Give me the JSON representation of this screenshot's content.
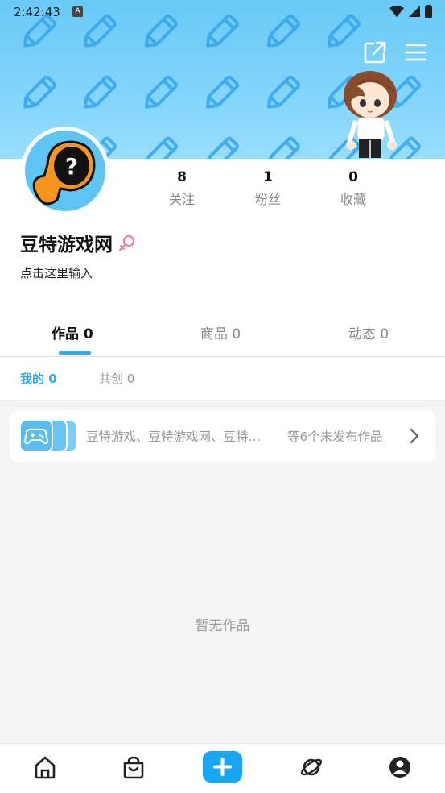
{
  "status": {
    "time": "2:42:43",
    "notif": "A"
  },
  "profile": {
    "stats": [
      {
        "num": "8",
        "label": "关注"
      },
      {
        "num": "1",
        "label": "粉丝"
      },
      {
        "num": "0",
        "label": "收藏"
      }
    ],
    "username": "豆特游戏网",
    "bio": "点击这里输入"
  },
  "tabs": [
    {
      "label": "作品 0"
    },
    {
      "label": "商品 0"
    },
    {
      "label": "动态 0"
    }
  ],
  "subtabs": [
    {
      "label": "我的 0"
    },
    {
      "label": "共创 0"
    }
  ],
  "draft": {
    "titles": "豆特游戏、豆特游戏网、豆特…",
    "count": "等6个未发布作品"
  },
  "empty_text": "暂无作品",
  "colors": {
    "accent": "#29aef2",
    "banner": "#7fd3fa",
    "avatar_orange": "#f7941d"
  }
}
